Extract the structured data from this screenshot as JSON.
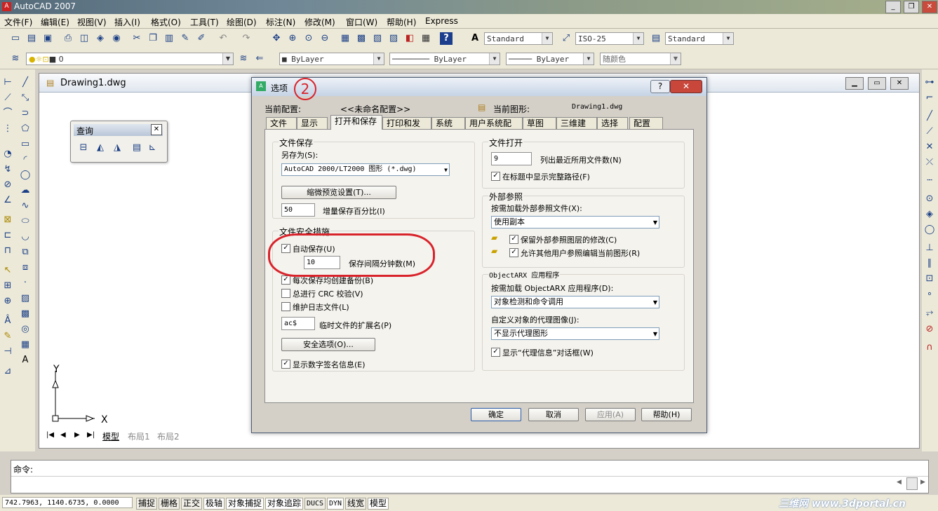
{
  "app": {
    "title": "AutoCAD 2007"
  },
  "menu": [
    "文件(F)",
    "编辑(E)",
    "视图(V)",
    "插入(I)",
    "格式(O)",
    "工具(T)",
    "绘图(D)",
    "标注(N)",
    "修改(M)",
    "窗口(W)",
    "帮助(H)",
    "Express"
  ],
  "styles_toolbar": {
    "text_style": "Standard",
    "dim_style": "ISO-25",
    "table_style": "Standard"
  },
  "layers_toolbar": {
    "layer": "0",
    "color": "ByLayer",
    "linetype": "ByLayer",
    "lineweight": "ByLayer",
    "plotstyle": "随颜色"
  },
  "drawing": {
    "title": "Drawing1.dwg",
    "tabs": [
      "模型",
      "布局1",
      "布局2"
    ],
    "ucs_y": "Y",
    "ucs_x": "X"
  },
  "query_toolbar": {
    "title": "查询"
  },
  "dialog": {
    "title": "选项",
    "annotation_number": "2",
    "profile_label": "当前配置:",
    "profile_value": "<<未命名配置>>",
    "drawing_label": "当前图形:",
    "drawing_value": "Drawing1.dwg",
    "tabs": [
      "文件",
      "显示",
      "打开和保存",
      "打印和发布",
      "系统",
      "用户系统配置",
      "草图",
      "三维建模",
      "选择",
      "配置"
    ],
    "file_save": {
      "group": "文件保存",
      "save_as_label": "另存为(S):",
      "save_as_value": "AutoCAD 2000/LT2000 图形 (*.dwg)",
      "thumbnail_btn": "缩微预览设置(T)...",
      "incremental_value": "50",
      "incremental_label": "增量保存百分比(I)"
    },
    "safety": {
      "group": "文件安全措施",
      "autosave_label": "自动保存(U)",
      "autosave_checked": true,
      "interval_value": "10",
      "interval_label": "保存间隔分钟数(M)",
      "backup_label": "每次保存均创建备份(B)",
      "backup_checked": true,
      "crc_label": "总进行 CRC 校验(V)",
      "crc_checked": false,
      "log_label": "维护日志文件(L)",
      "log_checked": false,
      "ext_value": "ac$",
      "ext_label": "临时文件的扩展名(P)",
      "security_btn": "安全选项(O)...",
      "signature_label": "显示数字签名信息(E)",
      "signature_checked": true
    },
    "file_open": {
      "group": "文件打开",
      "recent_value": "9",
      "recent_label": "列出最近所用文件数(N)",
      "fullpath_label": "在标题中显示完整路径(F)",
      "fullpath_checked": true
    },
    "xref": {
      "group": "外部参照",
      "demand_label": "按需加载外部参照文件(X):",
      "demand_value": "使用副本",
      "retain_label": "保留外部参照图层的修改(C)",
      "retain_checked": true,
      "allow_label": "允许其他用户参照编辑当前图形(R)",
      "allow_checked": true
    },
    "objectarx": {
      "group": "ObjectARX 应用程序",
      "load_label": "按需加载 ObjectARX 应用程序(D):",
      "load_value": "对象检测和命令调用",
      "proxy_label": "自定义对象的代理图像(J):",
      "proxy_value": "不显示代理图形",
      "proxyinfo_label": "显示“代理信息”对话框(W)",
      "proxyinfo_checked": true
    },
    "buttons": {
      "ok": "确定",
      "cancel": "取消",
      "apply": "应用(A)",
      "help": "帮助(H)"
    }
  },
  "command": {
    "prompt": "命令:"
  },
  "status": {
    "coords": "742.7963, 1140.6735, 0.0000",
    "toggles": [
      "捕捉",
      "栅格",
      "正交",
      "极轴",
      "对象捕捉",
      "对象追踪",
      "DUCS",
      "DYN",
      "线宽",
      "模型"
    ],
    "watermark": "三维网 www.3dportal.cn"
  },
  "colors": {
    "annotation_red": "#d9232b",
    "dialog_border": "#4b5d74"
  }
}
